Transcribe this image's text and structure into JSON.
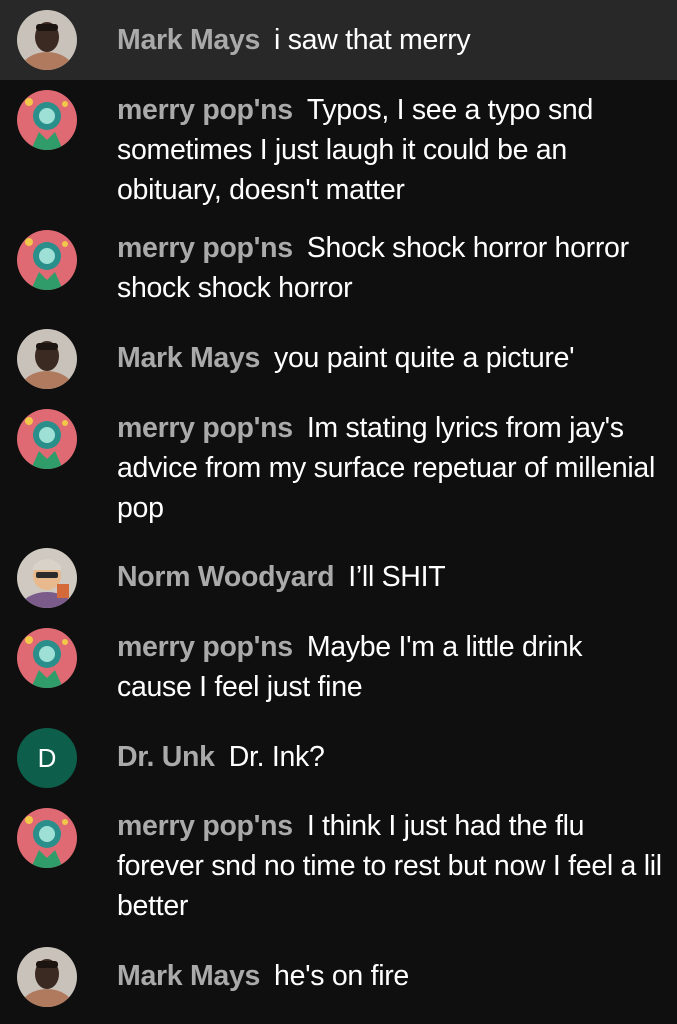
{
  "colors": {
    "background": "#0f0f0f",
    "highlight_row": "#282828",
    "author_name": "#aaaaaa",
    "message_text": "#ffffff",
    "letter_avatar_bg": "#0d5e4a"
  },
  "messages": [
    {
      "author": "Mark Mays",
      "text": "i saw that merry",
      "avatar": "mark-photo",
      "highlighted": true
    },
    {
      "author": "merry pop'ns",
      "text": "Typos, I see a typo snd sometimes I just laugh it could be an obituary, doesn't matter",
      "avatar": "merry-art"
    },
    {
      "author": "merry pop'ns",
      "text": "Shock shock horror horror shock shock horror",
      "avatar": "merry-art"
    },
    {
      "author": "Mark Mays",
      "text": "you paint quite a picture'",
      "avatar": "mark-photo"
    },
    {
      "author": "merry pop'ns",
      "text": "Im stating lyrics from jay's advice from my surface repetuar of millenial pop",
      "avatar": "merry-art"
    },
    {
      "author": "Norm Woodyard",
      "text": "I’ll SHIT",
      "avatar": "norm-photo"
    },
    {
      "author": "merry pop'ns",
      "text": "Maybe I'm a little drink cause I feel just fine",
      "avatar": "merry-art"
    },
    {
      "author": "Dr. Unk",
      "text": "Dr. Ink?",
      "avatar": "letter",
      "avatar_letter": "D"
    },
    {
      "author": "merry pop'ns",
      "text": "I think I just had the flu forever snd no time to rest but now I feel a lil better",
      "avatar": "merry-art"
    },
    {
      "author": "Mark Mays",
      "text": "he's on fire",
      "avatar": "mark-photo"
    }
  ]
}
